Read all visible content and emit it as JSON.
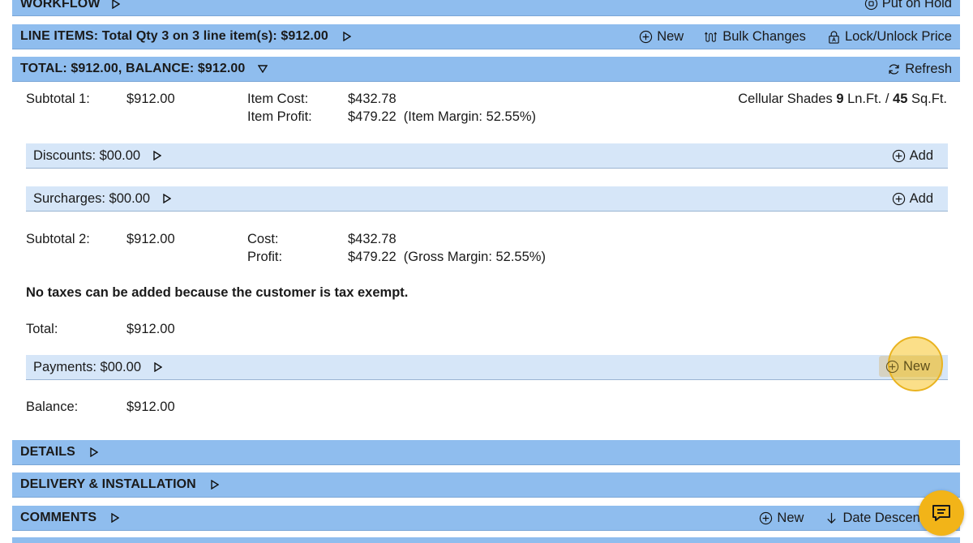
{
  "colors": {
    "section_bar": "#8fbdee",
    "sub_bar": "#d6e6f8",
    "highlight": "#f2b418"
  },
  "workflow": {
    "title": "WORKFLOW",
    "action": "Put on Hold",
    "action_icon": "pause-circle-icon"
  },
  "line_items": {
    "title": "LINE ITEMS: Total Qty 3 on 3 line item(s): $912.00",
    "new_label": "New",
    "bulk_label": "Bulk Changes",
    "lock_label": "Lock/Unlock Price"
  },
  "total": {
    "title": "TOTAL: $912.00, BALANCE: $912.00",
    "refresh_label": "Refresh",
    "subtotal1_label": "Subtotal 1:",
    "subtotal1_value": "$912.00",
    "item_cost_label": "Item Cost:",
    "item_cost_value": "$432.78",
    "item_profit_label": "Item Profit:",
    "item_profit_value": "$479.22  (Item Margin: 52.55%)",
    "shades_prefix": "Cellular Shades ",
    "shades_lnft": "9",
    "shades_mid": " Ln.Ft. / ",
    "shades_sqft": "45",
    "shades_suffix": " Sq.Ft.",
    "discounts_label": "Discounts: $00.00",
    "discounts_add": "Add",
    "surcharges_label": "Surcharges: $00.00",
    "surcharges_add": "Add",
    "subtotal2_label": "Subtotal 2:",
    "subtotal2_value": "$912.00",
    "cost_label": "Cost:",
    "cost_value": "$432.78",
    "profit_label": "Profit:",
    "profit_value": "$479.22  (Gross Margin: 52.55%)",
    "tax_note": "No taxes can be added because the customer is tax exempt.",
    "total_label": "Total:",
    "total_value": "$912.00",
    "payments_label": "Payments: $00.00",
    "payments_new": "New",
    "balance_label": "Balance:",
    "balance_value": "$912.00"
  },
  "details": {
    "title": "DETAILS"
  },
  "delivery": {
    "title": "DELIVERY & INSTALLATION"
  },
  "comments": {
    "title": "COMMENTS",
    "new_label": "New",
    "sort_label": "Date Descend"
  }
}
